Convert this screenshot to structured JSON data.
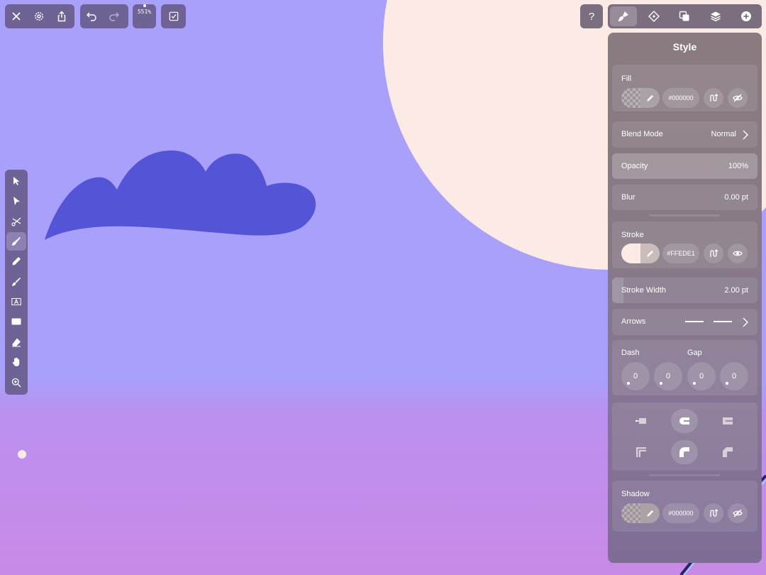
{
  "toolbar": {
    "zoom_label": "551%"
  },
  "inspector": {
    "title": "Style",
    "fill": {
      "label": "Fill",
      "hex": "#000000"
    },
    "blend_mode": {
      "label": "Blend Mode",
      "value": "Normal"
    },
    "opacity": {
      "label": "Opacity",
      "value": "100%"
    },
    "blur": {
      "label": "Blur",
      "value": "0.00 pt"
    },
    "stroke": {
      "label": "Stroke",
      "hex": "#FFEDE1",
      "color": "#fbebe4"
    },
    "stroke_width": {
      "label": "Stroke Width",
      "value": "2.00 pt"
    },
    "arrows": {
      "label": "Arrows"
    },
    "dash": {
      "label": "Dash",
      "values": [
        "0",
        "0"
      ]
    },
    "gap": {
      "label": "Gap",
      "values": [
        "0",
        "0"
      ]
    },
    "shadow": {
      "label": "Shadow",
      "hex": "#000000"
    }
  },
  "colors": {
    "canvas_top": "#a8a0fb",
    "canvas_bottom": "#c98ae6",
    "cloud": "#5454d6",
    "sun": "#fbebe4"
  }
}
